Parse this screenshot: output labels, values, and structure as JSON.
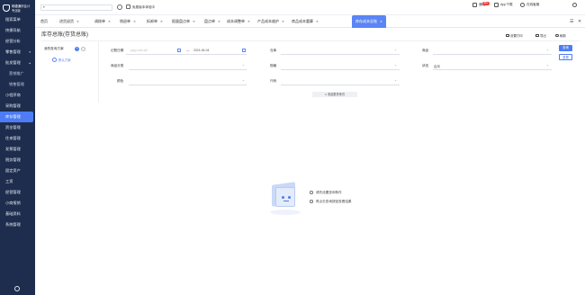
{
  "sidebar": {
    "logo_text": "畅捷通好会计",
    "logo_sub": "专业版",
    "items": [
      {
        "label": "搜索菜单"
      },
      {
        "label": "快捷导航"
      },
      {
        "label": "经营分析"
      },
      {
        "label": "零售管理",
        "caret": "▾"
      },
      {
        "label": "批发管理",
        "caret": "▴"
      },
      {
        "label": "营销推广",
        "sub": true
      },
      {
        "label": "销售管理",
        "sub": true
      },
      {
        "label": "小程序商"
      },
      {
        "label": "采购管理"
      },
      {
        "label": "库存管理",
        "active": true
      },
      {
        "label": "资金管理"
      },
      {
        "label": "往来管理"
      },
      {
        "label": "发票管理"
      },
      {
        "label": "税务管理"
      },
      {
        "label": "固定资产"
      },
      {
        "label": "工资"
      },
      {
        "label": "经营管理"
      },
      {
        "label": "小商报销"
      },
      {
        "label": "基础资料"
      },
      {
        "label": "系统管理"
      }
    ]
  },
  "topbar": {
    "company_placeholder": "",
    "switch_label": "免费版本体验中",
    "right": {
      "notice": "通知",
      "notice_badge": "99+",
      "app": "App下载",
      "user": "在线客服"
    }
  },
  "tabs": [
    {
      "label": "首页"
    },
    {
      "label": "进货退货"
    },
    {
      "label": "调拨单"
    },
    {
      "label": "销退单"
    },
    {
      "label": "拆卸单"
    },
    {
      "label": "报量盘点单"
    },
    {
      "label": "盘点单"
    },
    {
      "label": "成本调整单"
    },
    {
      "label": "产品成本维护"
    },
    {
      "label": "商品成本重算"
    },
    {
      "label": "库存成本总账",
      "active": true
    }
  ],
  "page": {
    "title": "库存总账(存货总账)",
    "actions": {
      "columns": "设置打印",
      "export": "导出",
      "refresh": "刷新"
    }
  },
  "schemes": {
    "header": "我的查询方案",
    "add": "+",
    "options": "⋯",
    "default_label": "默认方案"
  },
  "filters": {
    "date_label": "记账日期",
    "date_start_placeholder": "yyyy-mm-dd",
    "date_sep": "—",
    "date_end": "2021-06-04",
    "warehouse_label": "仓库",
    "goods_label": "商品",
    "goods_class_label": "商品分类",
    "spec_label": "规格",
    "status_label": "状态",
    "status_value": "启用",
    "color_label": "颜色",
    "size_label": "尺码",
    "query_button": "查询",
    "reset_button": "重置",
    "expand_label": "∧ 收起更多条件"
  },
  "empty": {
    "tip1": "请先设置查询条件",
    "tip2": "再点击查询按钮查看结果"
  }
}
